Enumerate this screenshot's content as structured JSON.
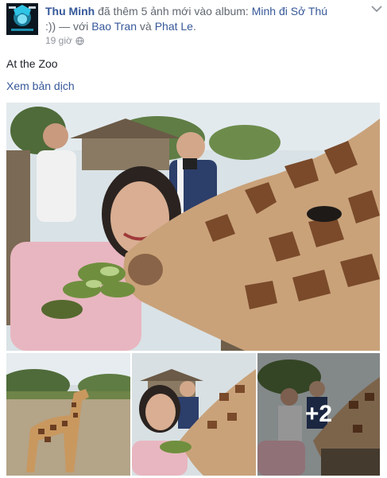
{
  "post": {
    "author": "Thu Minh",
    "action_text": "đã thêm 5 ảnh mới vào album:",
    "album_name": "Minh đi Sở Thú",
    "emoticon": ":))",
    "with_text": "— với",
    "tagged_1": "Bao Tran",
    "and_text": "và",
    "tagged_2": "Phat Le",
    "period": ".",
    "time_ago": "19 giờ",
    "privacy_icon": "globe-icon",
    "caption": "At the Zoo",
    "translate_label": "Xem bản dịch"
  },
  "photos": {
    "more_count": "+2"
  },
  "colors": {
    "link": "#365899",
    "meta": "#90949c",
    "text": "#1d2129"
  }
}
